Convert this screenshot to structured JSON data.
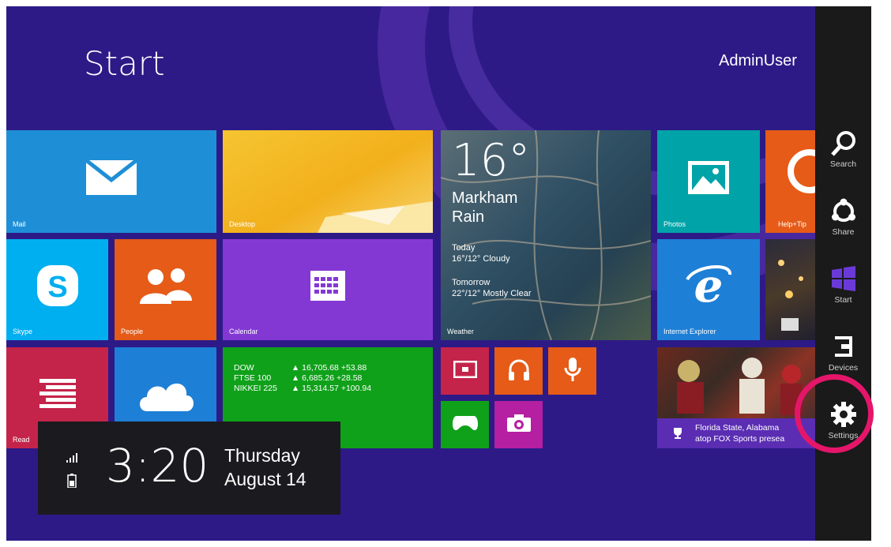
{
  "screen": {
    "title": "Start",
    "user": "AdminUser"
  },
  "tiles": {
    "mail": "Mail",
    "desktop": "Desktop",
    "photos": "Photos",
    "help": "Help+Tip",
    "skype": "Skype",
    "people": "People",
    "calendar": "Calendar",
    "ie": "Internet Explorer",
    "reading": "Read",
    "weather": {
      "temp": "16°",
      "city": "Markham",
      "condition": "Rain",
      "today_label": "Today",
      "today_forecast": "16°/12° Cloudy",
      "tomorrow_label": "Tomorrow",
      "tomorrow_forecast": "22°/12° Mostly Clear",
      "label": "Weather"
    },
    "finance": {
      "rows": [
        {
          "name": "DOW",
          "value": "▲ 16,705.68 +53.88"
        },
        {
          "name": "FTSE 100",
          "value": "▲ 6,685.26 +28.58"
        },
        {
          "name": "NIKKEI 225",
          "value": "▲ 15,314.57 +100.94"
        }
      ]
    },
    "sports": {
      "headline_1": "Florida State, Alabama",
      "headline_2": "atop FOX Sports presea"
    }
  },
  "clock": {
    "time": "3:20",
    "day": "Thursday",
    "date": "August 14"
  },
  "charms": [
    {
      "label": "Search",
      "icon": "search-icon"
    },
    {
      "label": "Share",
      "icon": "share-icon"
    },
    {
      "label": "Start",
      "icon": "windows-icon"
    },
    {
      "label": "Devices",
      "icon": "devices-icon"
    },
    {
      "label": "Settings",
      "icon": "gear-icon"
    }
  ],
  "colors": {
    "background": "#2d1a87",
    "highlight_ring": "#e5166a",
    "charms_bar": "#1a1a1a"
  }
}
